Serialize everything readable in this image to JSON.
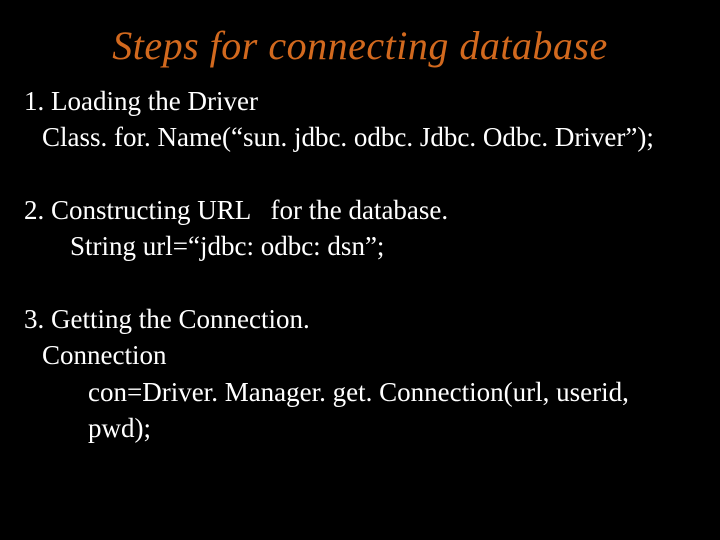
{
  "title": "Steps for connecting database",
  "steps": {
    "s1_head": "1. Loading the Driver",
    "s1_code": "Class. for. Name(“sun. jdbc. odbc. Jdbc. Odbc. Driver”);",
    "s2_head": "2. Constructing URL   for the database.",
    "s2_code": "String url=“jdbc: odbc: dsn”;",
    "s3_head": "3. Getting the Connection.",
    "s3_code1": "Connection",
    "s3_code2": "con=Driver. Manager. get. Connection(url, userid, pwd);"
  }
}
